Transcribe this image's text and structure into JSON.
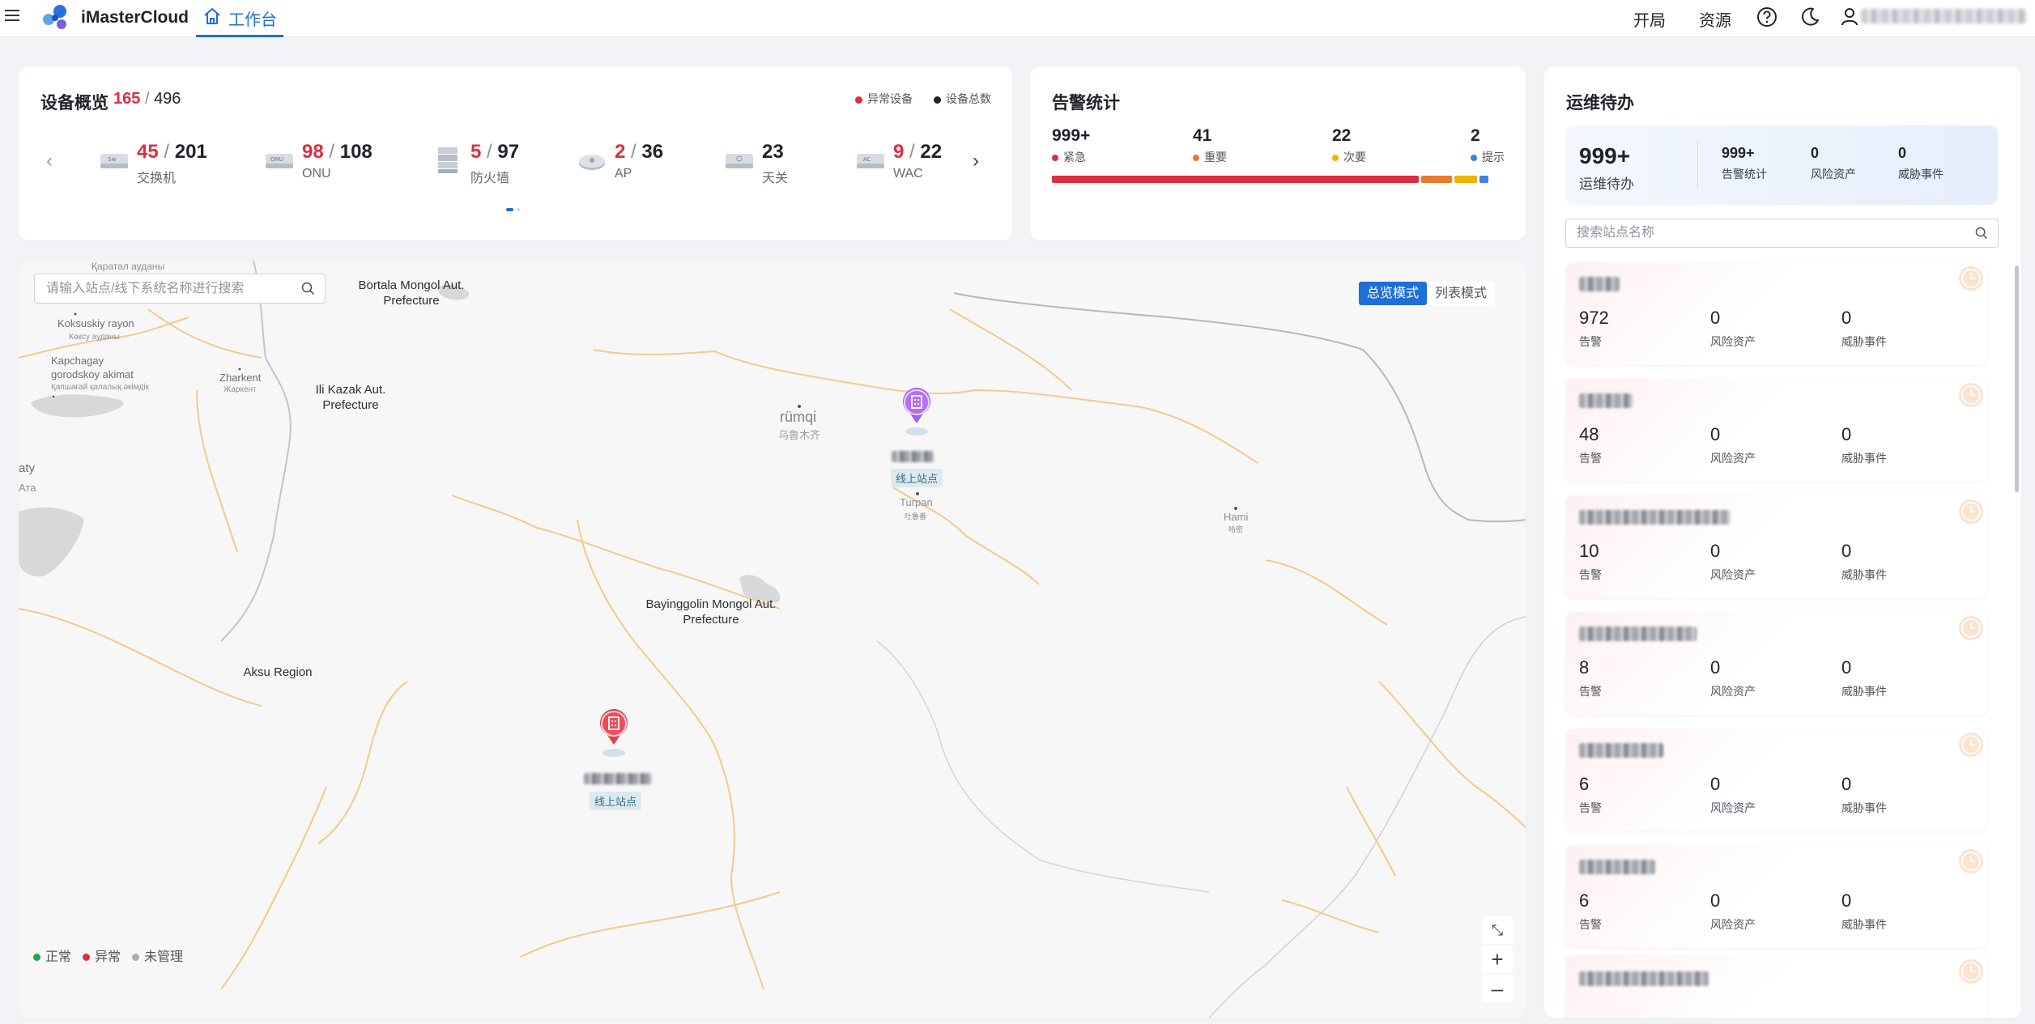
{
  "app": {
    "name": "iMasterCloud"
  },
  "header": {
    "tab_label": "工作台",
    "links": {
      "layout": "开局",
      "resources": "资源"
    },
    "icons": [
      "menu-icon",
      "home-icon",
      "help-icon",
      "moon-icon",
      "user-icon"
    ]
  },
  "device_overview": {
    "title": "设备概览",
    "abnormal": "165",
    "sep": "/",
    "total": "496",
    "legend": {
      "abnormal": "异常设备",
      "total": "设备总数"
    },
    "colors": {
      "abnormal": "#e02c3f",
      "total": "#1f2329"
    },
    "items": [
      {
        "abnormal": "45",
        "total": "201",
        "label": "交换机",
        "icon": "switch-icon"
      },
      {
        "abnormal": "98",
        "total": "108",
        "label": "ONU",
        "icon": "onu-icon"
      },
      {
        "abnormal": "5",
        "total": "97",
        "label": "防火墙",
        "icon": "firewall-icon"
      },
      {
        "abnormal": "2",
        "total": "36",
        "label": "AP",
        "icon": "ap-icon"
      },
      {
        "abnormal": "",
        "total": "23",
        "label": "天关",
        "icon": "gateway-icon"
      },
      {
        "abnormal": "9",
        "total": "22",
        "label": "WAC",
        "icon": "wac-icon"
      }
    ],
    "pager": {
      "pages": 2,
      "current": 1
    }
  },
  "alarm_stats": {
    "title": "告警统计",
    "items": [
      {
        "value": "999+",
        "label": "紧急",
        "color": "#e02c3f",
        "share": 0.82
      },
      {
        "value": "41",
        "label": "重要",
        "color": "#e8792a",
        "share": 0.07
      },
      {
        "value": "22",
        "label": "次要",
        "color": "#f0b400",
        "share": 0.05
      },
      {
        "value": "2",
        "label": "提示",
        "color": "#3b82e6",
        "share": 0.02
      }
    ]
  },
  "map": {
    "search_placeholder": "请输入站点/线下系统名称进行搜索",
    "modes": {
      "overview": "总览模式",
      "list": "列表模式"
    },
    "active_mode": "overview",
    "labels": {
      "karatal": "Қаратал ауданы",
      "koksu_en": "Koksuskiy rayon",
      "koksu_kz": "Көксу ауданы",
      "kapchagay": "Kapchagay gorodskoy akimat",
      "kapchagay_kz": "Қапшағай қалалық әкімдік",
      "zharkent": "Zharkent",
      "zharkent_kz": "Жаркент",
      "bortala": "Bortala Mongol Aut. Prefecture",
      "ili": "Ili Kazak Aut. Prefecture",
      "aty": "aty",
      "ata": "Ата",
      "urumqi": "rümqi",
      "urumqi_cn": "乌鲁木齐",
      "turpan": "Turpan",
      "turpan_cn": "吐鲁番",
      "hami": "Hami",
      "hami_cn": "哈密",
      "bayinggolin": "Bayinggolin Mongol Aut. Prefecture",
      "aksu": "Aksu Region"
    },
    "sites": [
      {
        "tag": "线上站点",
        "status": "normal-purple"
      },
      {
        "tag": "线上站点",
        "status": "abnormal"
      }
    ],
    "legend": {
      "normal": "正常",
      "abnormal": "异常",
      "unmanaged": "未管理"
    },
    "legend_colors": {
      "normal": "#22a352",
      "abnormal": "#e02c3f",
      "unmanaged": "#a8adb4"
    },
    "controls": {
      "zoom_in": "+",
      "zoom_out": "–"
    }
  },
  "ops": {
    "title": "运维待办",
    "summary": {
      "total": "999+",
      "total_label": "运维待办",
      "alarm": "999+",
      "alarm_label": "告警统计",
      "risk": "0",
      "risk_label": "风险资产",
      "threat": "0",
      "threat_label": "威胁事件"
    },
    "search_placeholder": "搜索站点名称",
    "col_labels": {
      "alarm": "告警",
      "risk": "风险资产",
      "threat": "威胁事件"
    },
    "sites": [
      {
        "alarm": "972",
        "risk": "0",
        "threat": "0"
      },
      {
        "alarm": "48",
        "risk": "0",
        "threat": "0"
      },
      {
        "alarm": "10",
        "risk": "0",
        "threat": "0"
      },
      {
        "alarm": "8",
        "risk": "0",
        "threat": "0"
      },
      {
        "alarm": "6",
        "risk": "0",
        "threat": "0"
      },
      {
        "alarm": "6",
        "risk": "0",
        "threat": "0"
      }
    ]
  }
}
